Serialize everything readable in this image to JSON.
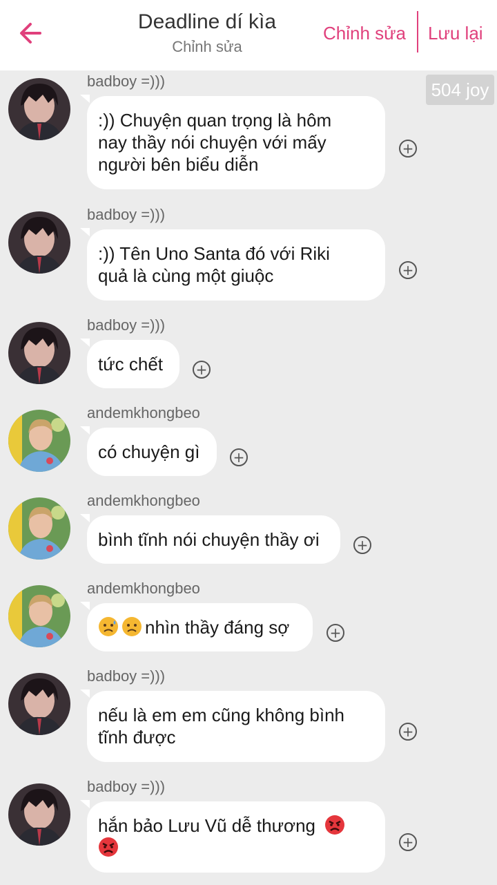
{
  "header": {
    "title": "Deadline dí kìa",
    "subtitle": "Chỉnh sửa",
    "edit_label": "Chỉnh sửa",
    "save_label": "Lưu lại",
    "accent_color": "#e0407c"
  },
  "joy_badge": "504 joy",
  "messages": [
    {
      "sender": "badboy =)))",
      "avatar": "badboy-avatar",
      "lines": [
        ":)) Chuyện quan trọng là hôm",
        "nay thầy nói chuyện với mấy",
        "người bên biểu diễn"
      ]
    },
    {
      "sender": "badboy =)))",
      "avatar": "badboy-avatar",
      "lines": [
        ":)) Tên Uno Santa đó với Riki",
        "quả là cùng một giuộc"
      ]
    },
    {
      "sender": "badboy =)))",
      "avatar": "badboy-avatar",
      "lines": [
        "tức chết"
      ]
    },
    {
      "sender": "andemkhongbeo",
      "avatar": "andemkhongbeo-avatar",
      "lines": [
        "có chuyện gì"
      ]
    },
    {
      "sender": "andemkhongbeo",
      "avatar": "andemkhongbeo-avatar",
      "lines": [
        "bình tĩnh nói chuyện thầy ơi"
      ]
    },
    {
      "sender": "andemkhongbeo",
      "avatar": "andemkhongbeo-avatar",
      "lines": [
        "nhìn thầy đáng sợ"
      ],
      "leading_emojis": [
        "sad-sweat-face-emoji",
        "sad-sweat-face-emoji"
      ]
    },
    {
      "sender": "badboy =)))",
      "avatar": "badboy-avatar",
      "lines": [
        "nếu là em em cũng không bình",
        "tĩnh được"
      ]
    },
    {
      "sender": "badboy =)))",
      "avatar": "badboy-avatar",
      "lines": [
        "hắn bảo Lưu Vũ dễ thương",
        ""
      ],
      "trailing_emojis": [
        "angry-face-emoji",
        "angry-face-emoji"
      ]
    }
  ]
}
